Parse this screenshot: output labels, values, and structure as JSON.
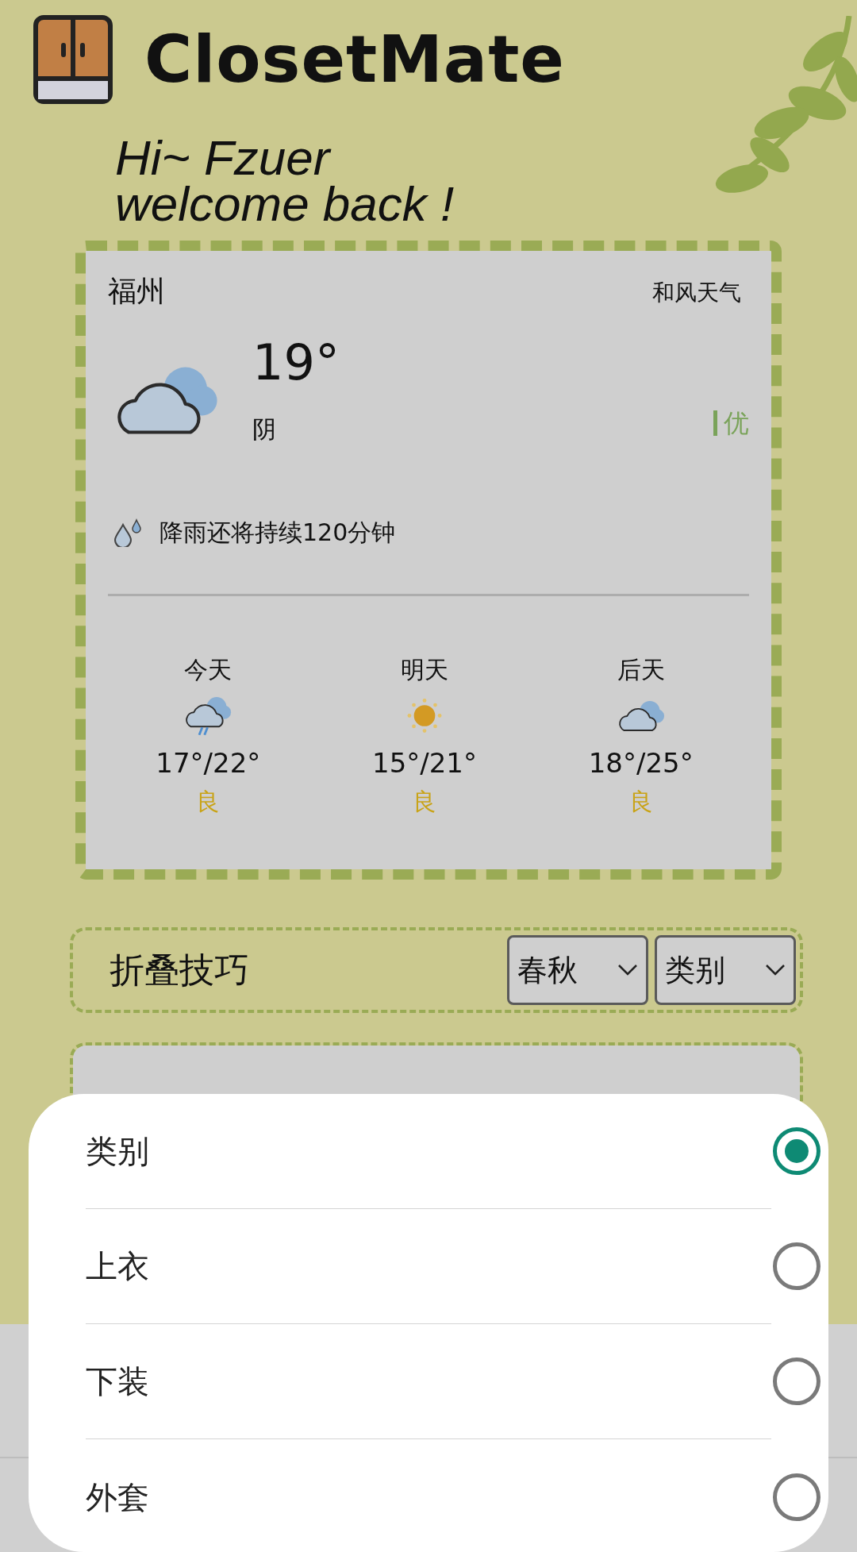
{
  "app": {
    "title": "ClosetMate"
  },
  "greeting": [
    "Hi~ Fzuer",
    "welcome back !"
  ],
  "weather": {
    "city": "福州",
    "provider": "和风天气",
    "temperature": "19°",
    "condition": "阴",
    "kind": "cloudy",
    "air_quality": "优",
    "rain_notice": "降雨还将持续120分钟",
    "forecast": [
      {
        "day": "今天",
        "kind": "rain",
        "range": "17°/22°",
        "air_quality": "良"
      },
      {
        "day": "明天",
        "kind": "sunny",
        "range": "15°/21°",
        "air_quality": "良"
      },
      {
        "day": "后天",
        "kind": "cloudy",
        "range": "18°/25°",
        "air_quality": "良"
      }
    ]
  },
  "section": {
    "title": "折叠技巧",
    "filters": [
      {
        "value": "春秋"
      },
      {
        "value": "类别"
      }
    ]
  },
  "sheet": {
    "options": [
      {
        "label": "类别",
        "selected": true
      },
      {
        "label": "上衣",
        "selected": false
      },
      {
        "label": "下装",
        "selected": false
      },
      {
        "label": "外套",
        "selected": false
      }
    ]
  }
}
